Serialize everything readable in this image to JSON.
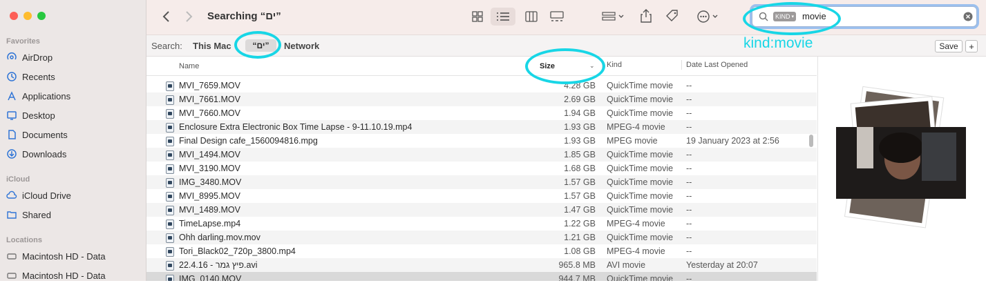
{
  "window": {
    "title": "Searching “ים”"
  },
  "sidebar": {
    "favorites_header": "Favorites",
    "favorites": [
      {
        "label": "AirDrop",
        "icon": "airdrop-icon"
      },
      {
        "label": "Recents",
        "icon": "clock-icon"
      },
      {
        "label": "Applications",
        "icon": "applications-icon"
      },
      {
        "label": "Desktop",
        "icon": "desktop-icon"
      },
      {
        "label": "Documents",
        "icon": "document-icon"
      },
      {
        "label": "Downloads",
        "icon": "download-icon"
      }
    ],
    "icloud_header": "iCloud",
    "icloud": [
      {
        "label": "iCloud Drive",
        "icon": "cloud-icon"
      },
      {
        "label": "Shared",
        "icon": "shared-folder-icon"
      }
    ],
    "locations_header": "Locations",
    "locations": [
      {
        "label": "Macintosh HD - Data",
        "icon": "disk-icon"
      },
      {
        "label": "Macintosh HD - Data",
        "icon": "disk-icon"
      }
    ]
  },
  "search": {
    "token": "KIND",
    "query": "movie",
    "scope_label": "Search:",
    "scopes": [
      "This Mac",
      "“ים”",
      "Network"
    ],
    "selected_scope": "“ים”",
    "save_label": "Save",
    "add_label": "+"
  },
  "annotation": {
    "text": "kind:movie",
    "color": "#18d6e6"
  },
  "columns": {
    "name": "Name",
    "size": "Size",
    "kind": "Kind",
    "date": "Date Last Opened"
  },
  "files": [
    {
      "name": "MVI_7659.MOV",
      "size": "4.28 GB",
      "kind": "QuickTime movie",
      "date": "--"
    },
    {
      "name": "MVI_7661.MOV",
      "size": "2.69 GB",
      "kind": "QuickTime movie",
      "date": "--"
    },
    {
      "name": "MVI_7660.MOV",
      "size": "1.94 GB",
      "kind": "QuickTime movie",
      "date": "--"
    },
    {
      "name": "Enclosure Extra Electronic Box Time Lapse - 9-11.10.19.mp4",
      "size": "1.93 GB",
      "kind": "MPEG-4 movie",
      "date": "--"
    },
    {
      "name": "Final Design cafe_1560094816.mpg",
      "size": "1.93 GB",
      "kind": "MPEG movie",
      "date": "19 January 2023 at 2:56"
    },
    {
      "name": "MVI_1494.MOV",
      "size": "1.85 GB",
      "kind": "QuickTime movie",
      "date": "--"
    },
    {
      "name": "MVI_3190.MOV",
      "size": "1.68 GB",
      "kind": "QuickTime movie",
      "date": "--"
    },
    {
      "name": "IMG_3480.MOV",
      "size": "1.57 GB",
      "kind": "QuickTime movie",
      "date": "--"
    },
    {
      "name": "MVI_8995.MOV",
      "size": "1.57 GB",
      "kind": "QuickTime movie",
      "date": "--"
    },
    {
      "name": "MVI_1489.MOV",
      "size": "1.47 GB",
      "kind": "QuickTime movie",
      "date": "--"
    },
    {
      "name": "TimeLapse.mp4",
      "size": "1.22 GB",
      "kind": "MPEG-4 movie",
      "date": "--"
    },
    {
      "name": "Ohh darling.mov.mov",
      "size": "1.21 GB",
      "kind": "QuickTime movie",
      "date": "--"
    },
    {
      "name": "Tori_Black02_720p_3800.mp4",
      "size": "1.08 GB",
      "kind": "MPEG-4 movie",
      "date": "--"
    },
    {
      "name": "22.4.16 - פיץ גמר.avi",
      "size": "965.8 MB",
      "kind": "AVI movie",
      "date": "Yesterday at 20:07"
    },
    {
      "name": "IMG_0140.MOV",
      "size": "944.7 MB",
      "kind": "QuickTime movie",
      "date": "--"
    }
  ]
}
